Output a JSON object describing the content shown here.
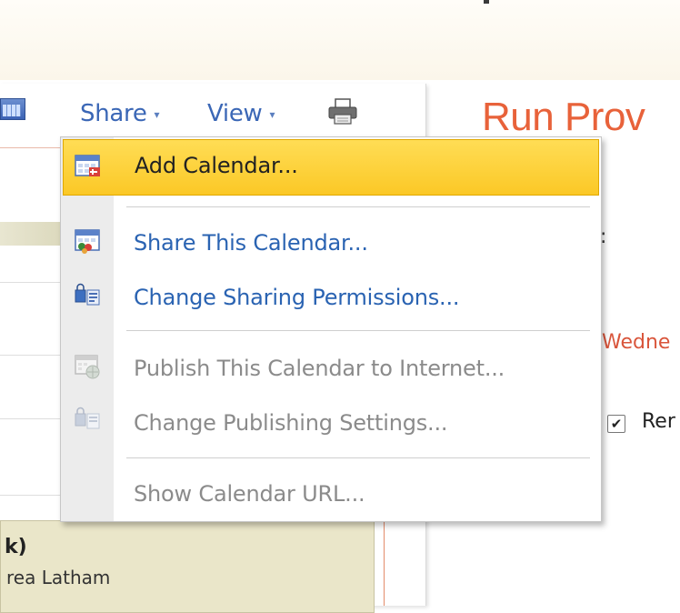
{
  "toolbar": {
    "share_label": "Share",
    "view_label": "View",
    "share_caret": "▾",
    "view_caret": "▾"
  },
  "menu": {
    "items": [
      {
        "label": "Add Calendar...",
        "icon": "add-calendar-icon",
        "state": "highlighted"
      },
      {
        "label": "Share This Calendar...",
        "icon": "share-calendar-icon",
        "state": "enabled"
      },
      {
        "label": "Change Sharing Permissions...",
        "icon": "sharing-permissions-icon",
        "state": "enabled"
      },
      {
        "label": "Publish This Calendar to Internet...",
        "icon": "publish-calendar-icon",
        "state": "disabled"
      },
      {
        "label": "Change Publishing Settings...",
        "icon": "publishing-settings-icon",
        "state": "disabled"
      },
      {
        "label": "Show Calendar URL...",
        "icon": "",
        "state": "disabled"
      }
    ]
  },
  "right_panel": {
    "title_fragment": "Run Prov",
    "colon": ":",
    "day_fragment": "Wedne",
    "checkbox_checked": true,
    "checkbox_label_fragment": "Rer"
  },
  "event": {
    "title_fragment": "k)",
    "subtitle_fragment": "rea Latham"
  },
  "colors": {
    "highlight": "#fbc826",
    "link_blue": "#2a63b2",
    "accent_orange": "#e8623a",
    "disabled_gray": "#8b8b8b"
  }
}
